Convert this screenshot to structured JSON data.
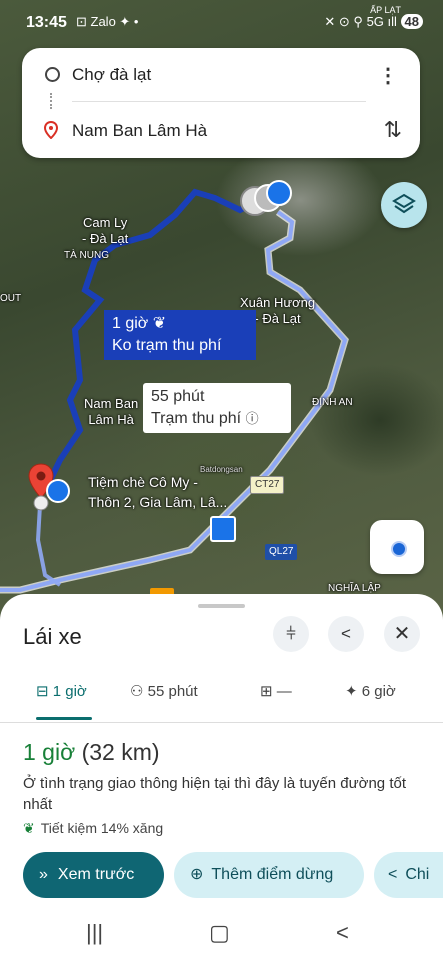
{
  "status_bar": {
    "time": "13:45",
    "apps": "⊡ Zalo ✦ •",
    "carrier": "ẤP LẠT",
    "icons": "✕ ⊙ ⚲ 5G ıll",
    "battery": "48"
  },
  "directions": {
    "origin": "Chợ đà lạt",
    "destination": "Nam Ban Lâm Hà",
    "more_icon": "⋮",
    "swap_icon": "⇅"
  },
  "map": {
    "labels": {
      "cam_ly": "Cam Ly\n- Đà Lạt",
      "ta_nung": "TÀ NUNG",
      "out": "OUT",
      "xuan_huong": "Xuân Hương\n- Đà Lạt",
      "nam_ban": "Nam Ban\nLâm Hà",
      "dinh_an": "ĐỊNH AN",
      "tiem_che": "Tiệm chè Cô My -\nThôn 2, Gia Lâm, Lâ...",
      "nghia_lap": "NGHĨA LẬP",
      "ct27": "CT27",
      "ql27": "QL27",
      "batdongsan": "Batdongsan"
    },
    "route_primary": {
      "duration": "1 giờ",
      "note": "Ko trạm thu phí"
    },
    "route_alt": {
      "duration": "55 phút",
      "note": "Trạm thu phí"
    }
  },
  "sheet": {
    "title": "Lái xe",
    "tabs": [
      {
        "label": "1 giờ",
        "icon": "car-icon"
      },
      {
        "label": "55 phút",
        "icon": "motorbike-icon"
      },
      {
        "label": "—",
        "icon": "transit-icon"
      },
      {
        "label": "6 giờ",
        "icon": "walk-icon"
      }
    ],
    "duration": "1 giờ",
    "distance": "(32 km)",
    "description": "Ở tình trạng giao thông hiện tại thì đây là tuyến đường tốt nhất",
    "saving": "Tiết kiệm 14% xăng",
    "buttons": {
      "preview": "Xem trước",
      "add_stop": "Thêm điểm dừng",
      "share": "Chi"
    }
  },
  "colors": {
    "accent": "#0f6673",
    "route_blue": "#1a3fb8",
    "green": "#188038"
  }
}
